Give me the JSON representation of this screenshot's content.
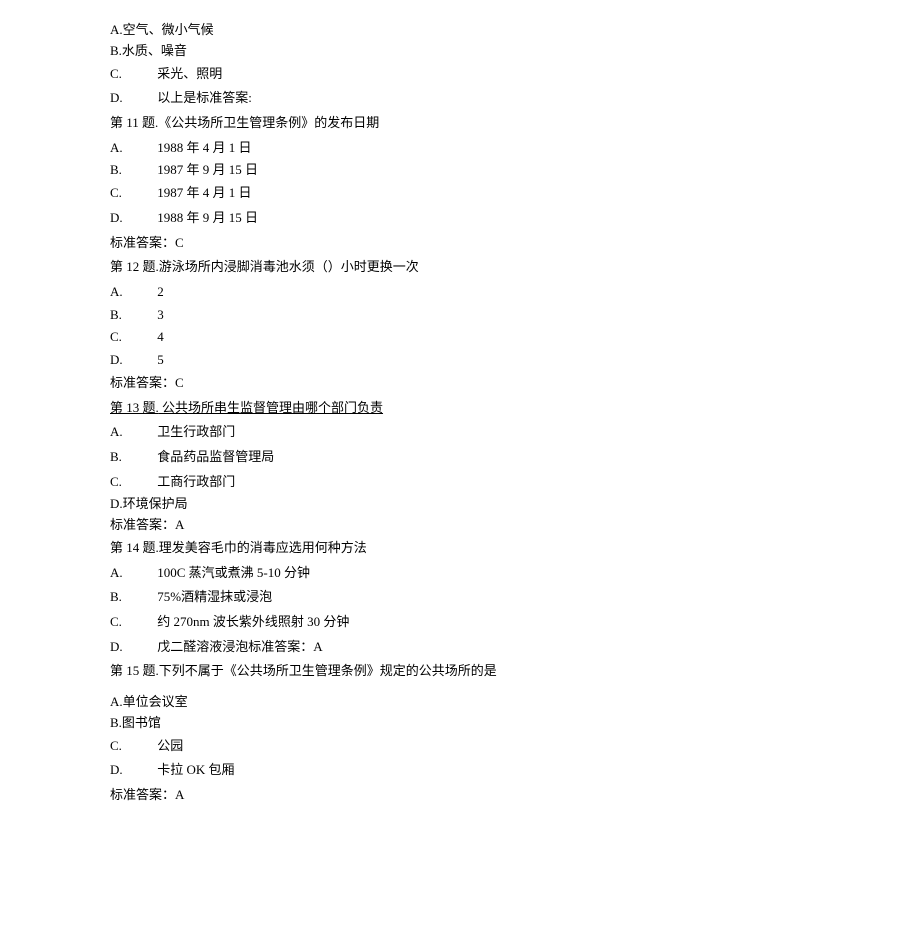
{
  "q10": {
    "optA": "A.空气、微小气候",
    "optB": "B.水质、噪音",
    "optC_label": "C.",
    "optC_text": "采光、照明",
    "optD_label": "D.",
    "optD_text": "以上是标准答案:"
  },
  "q11": {
    "title": "第 11 题.《公共场所卫生管理条例》的发布日期",
    "optA_label": "A.",
    "optA_text": "1988 年 4 月 1 日",
    "optB_label": "B.",
    "optB_text": "1987 年 9 月 15 日",
    "optC_label": "C.",
    "optC_text": "1987 年 4 月 1 日",
    "optD_label": "D.",
    "optD_text": "1988 年 9 月 15 日",
    "answer": "标准答案：C"
  },
  "q12": {
    "title": "第 12 题.游泳场所内浸脚消毒池水须（）小时更换一次",
    "optA_label": "A.",
    "optA_text": "2",
    "optB_label": "B.",
    "optB_text": "3",
    "optC_label": "C.",
    "optC_text": "4",
    "optD_label": "D.",
    "optD_text": "5",
    "answer": "标准答案：C"
  },
  "q13": {
    "title_prefix": "第 13 题.",
    "title_link": " 公共场所串生监督管理由哪个部门负责",
    "optA_label": "A.",
    "optA_text": "卫生行政部门",
    "optB_label": "B.",
    "optB_text": "食品药品监督管理局",
    "optC_label": "C.",
    "optC_text": "工商行政部门",
    "optD": "D.环境保护局",
    "answer": "标准答案：A"
  },
  "q14": {
    "title": "第 14 题.理发美容毛巾的消毒应选用何种方法",
    "optA_label": "A.",
    "optA_text": "100C 蒸汽或煮沸 5-10 分钟",
    "optB_label": "B.",
    "optB_text": "75%酒精湿抹或浸泡",
    "optC_label": "C.",
    "optC_text": "约 270nm 波长紫外线照射 30 分钟",
    "optD_label": "D.",
    "optD_text": "戊二醛溶液浸泡标准答案：A"
  },
  "q15": {
    "title": "第 15 题.下列不属于《公共场所卫生管理条例》规定的公共场所的是",
    "optA": "A.单位会议室",
    "optB": "B.图书馆",
    "optC_label": "C.",
    "optC_text": "公园",
    "optD_label": "D.",
    "optD_text": "卡拉 OK 包厢",
    "answer": "标准答案：A"
  }
}
